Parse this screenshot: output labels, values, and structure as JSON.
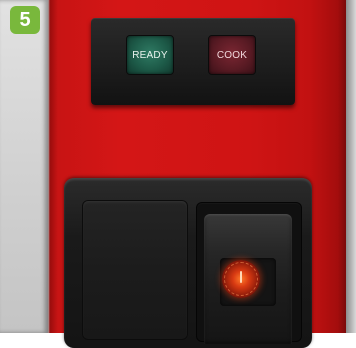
{
  "step": {
    "number": "5"
  },
  "indicator_panel": {
    "ready_label": "READY",
    "cook_label": "COOK"
  },
  "colors": {
    "step_badge": "#79b83c",
    "ready_lamp": "#1d5a48",
    "cook_lamp": "#5a1b24",
    "panel_red": "#d41616",
    "switch_black": "#1a1a1a",
    "power_lamp": "#d83a12"
  },
  "icons": {
    "power_switch": "power-lamp-icon"
  }
}
